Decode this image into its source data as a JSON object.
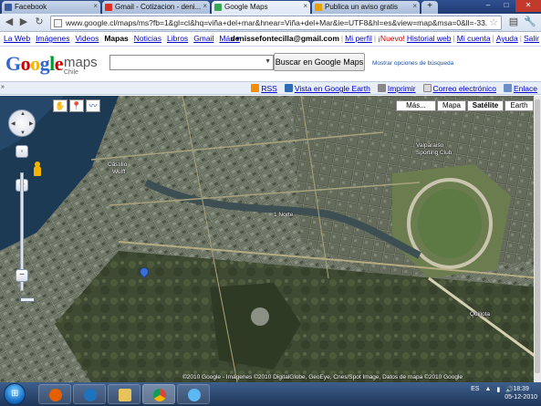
{
  "browser": {
    "tabs": [
      {
        "title": "Facebook",
        "favicon_color": "#3b5998"
      },
      {
        "title": "Gmail - Cotizacion - deni...",
        "favicon_color": "#d93025"
      },
      {
        "title": "Google Maps",
        "favicon_color": "#34a853"
      },
      {
        "title": "Publica un aviso gratis",
        "favicon_color": "#e8a200"
      }
    ],
    "active_tab_index": 2,
    "url": "www.google.cl/maps/ms?fb=1&gl=cl&hq=viña+del+mar&hnear=Viña+del+Mar&ie=UTF8&hl=es&view=map&msa=0&ll=-33."
  },
  "gbar": {
    "left_links": [
      "La Web",
      "Imágenes",
      "Videos",
      "Mapas",
      "Noticias",
      "Libros",
      "Gmail",
      "Más ▾"
    ],
    "selected": "Mapas",
    "email": "denissefontecilla@gmail.com",
    "mi_perfil": "Mi perfil",
    "nuevo": "¡Nuevo!",
    "historial": "Historial web",
    "mi_cuenta": "Mi cuenta",
    "ayuda": "Ayuda",
    "salir": "Salir"
  },
  "header": {
    "logo_text": "Google",
    "logo_product": "maps",
    "country": "Chile",
    "search_value": "",
    "search_button": "Buscar en Google Maps",
    "search_options": "Mostrar opciones de búsqueda"
  },
  "linksbar": {
    "rss": "RSS",
    "google_earth": "Vista en Google Earth",
    "imprimir": "Imprimir",
    "correo": "Correo electrónico",
    "enlace": "Enlace"
  },
  "map": {
    "types": [
      "Más...",
      "Mapa",
      "Satélite",
      "Earth"
    ],
    "selected_type": "Satélite",
    "labels": [
      {
        "text": "Castillo"
      },
      {
        "text": "Wulff"
      },
      {
        "text": "Valparaiso"
      },
      {
        "text": "Sporting Club"
      },
      {
        "text": "1 Norte"
      },
      {
        "text": "Quillota"
      }
    ],
    "copyright": "©2010 Google - Imágenes ©2010 DigitalGlobe, GeoEye, Cnes/Spot Image, Datos de mapa ©2010 Google"
  },
  "taskbar": {
    "apps": [
      {
        "name": "firefox",
        "color": "#e66000"
      },
      {
        "name": "internet-explorer",
        "color": "#1e73be"
      },
      {
        "name": "folder",
        "color": "#e8c35a"
      },
      {
        "name": "chrome",
        "color": "#34a853"
      },
      {
        "name": "star",
        "color": "#5bb8f0"
      }
    ],
    "lang": "ES",
    "time": "18:39",
    "date": "05-12-2010"
  }
}
